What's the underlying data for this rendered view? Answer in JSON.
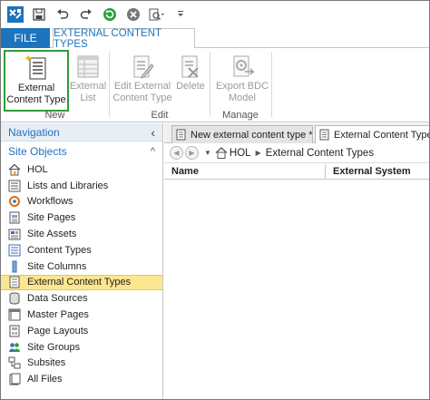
{
  "quick_access": {
    "buttons": [
      {
        "name": "sharepoint-app-icon"
      },
      {
        "name": "save-icon"
      },
      {
        "name": "undo-icon"
      },
      {
        "name": "redo-icon"
      },
      {
        "name": "refresh-icon"
      },
      {
        "name": "stop-icon"
      },
      {
        "name": "preview-icon"
      },
      {
        "name": "customize-qat-icon"
      }
    ]
  },
  "ribbon": {
    "tabs": {
      "file": "FILE",
      "active": "EXTERNAL CONTENT TYPES"
    },
    "groups": {
      "new": "New",
      "edit": "Edit",
      "manage": "Manage"
    },
    "buttons": {
      "external_content_type": "External Content Type",
      "external_list": "External List",
      "edit_external_content_type": "Edit External Content Type",
      "delete": "Delete",
      "export_bdc_model": "Export BDC Model"
    },
    "colors": {
      "file_tab": "#1e73be",
      "selected_outline": "#2e9d3a",
      "disabled_text": "#9a9a9a"
    }
  },
  "navigation": {
    "header": "Navigation",
    "collapse_glyph": "‹",
    "section": "Site Objects",
    "section_glyph": "^",
    "items": [
      {
        "label": "HOL",
        "icon": "home-icon"
      },
      {
        "label": "Lists and Libraries",
        "icon": "list-icon"
      },
      {
        "label": "Workflows",
        "icon": "workflow-icon"
      },
      {
        "label": "Site Pages",
        "icon": "page-icon"
      },
      {
        "label": "Site Assets",
        "icon": "assets-icon"
      },
      {
        "label": "Content Types",
        "icon": "content-types-icon"
      },
      {
        "label": "Site Columns",
        "icon": "column-icon"
      },
      {
        "label": "External Content Types",
        "icon": "external-content-types-icon",
        "active": true
      },
      {
        "label": "Data Sources",
        "icon": "database-icon"
      },
      {
        "label": "Master Pages",
        "icon": "master-page-icon"
      },
      {
        "label": "Page Layouts",
        "icon": "page-layout-icon"
      },
      {
        "label": "Site Groups",
        "icon": "group-icon"
      },
      {
        "label": "Subsites",
        "icon": "subsite-icon"
      },
      {
        "label": "All Files",
        "icon": "folder-icon"
      }
    ],
    "active_color": "#fce68f"
  },
  "main": {
    "tabs": [
      {
        "label": "New external content type *"
      },
      {
        "label": "External Content Types"
      }
    ],
    "breadcrumb": {
      "root": "HOL",
      "current": "External Content Types"
    },
    "columns": [
      "Name",
      "External System"
    ]
  }
}
